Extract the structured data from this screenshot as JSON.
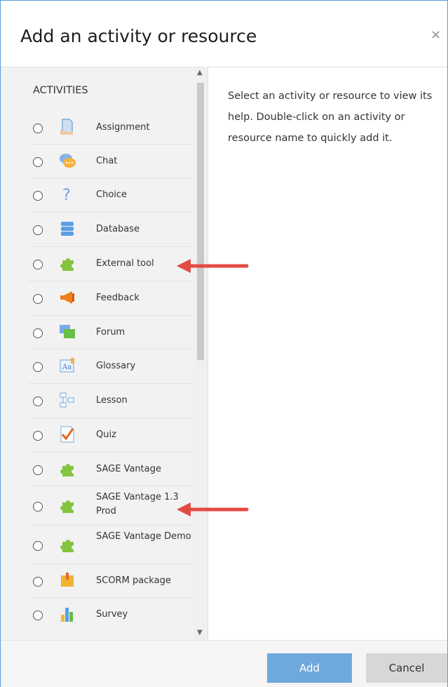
{
  "dialog": {
    "title": "Add an activity or resource",
    "close": "×"
  },
  "left": {
    "category": "ACTIVITIES",
    "items": [
      {
        "label": "Assignment",
        "icon": "assignment-icon"
      },
      {
        "label": "Chat",
        "icon": "chat-icon"
      },
      {
        "label": "Choice",
        "icon": "choice-icon"
      },
      {
        "label": "Database",
        "icon": "database-icon"
      },
      {
        "label": "External tool",
        "icon": "external-tool-icon"
      },
      {
        "label": "Feedback",
        "icon": "feedback-icon"
      },
      {
        "label": "Forum",
        "icon": "forum-icon"
      },
      {
        "label": "Glossary",
        "icon": "glossary-icon"
      },
      {
        "label": "Lesson",
        "icon": "lesson-icon"
      },
      {
        "label": "Quiz",
        "icon": "quiz-icon"
      },
      {
        "label": "SAGE Vantage",
        "icon": "sage-vantage-icon"
      },
      {
        "label": "SAGE Vantage 1.3 Prod",
        "icon": "sage-vantage-prod-icon"
      },
      {
        "label": "SAGE Vantage Demo",
        "icon": "sage-vantage-demo-icon"
      },
      {
        "label": "SCORM package",
        "icon": "scorm-package-icon"
      },
      {
        "label": "Survey",
        "icon": "survey-icon"
      }
    ]
  },
  "right": {
    "help": "Select an activity or resource to view its help. Double-click on an activity or resource name to quickly add it."
  },
  "footer": {
    "add": "Add",
    "cancel": "Cancel"
  }
}
